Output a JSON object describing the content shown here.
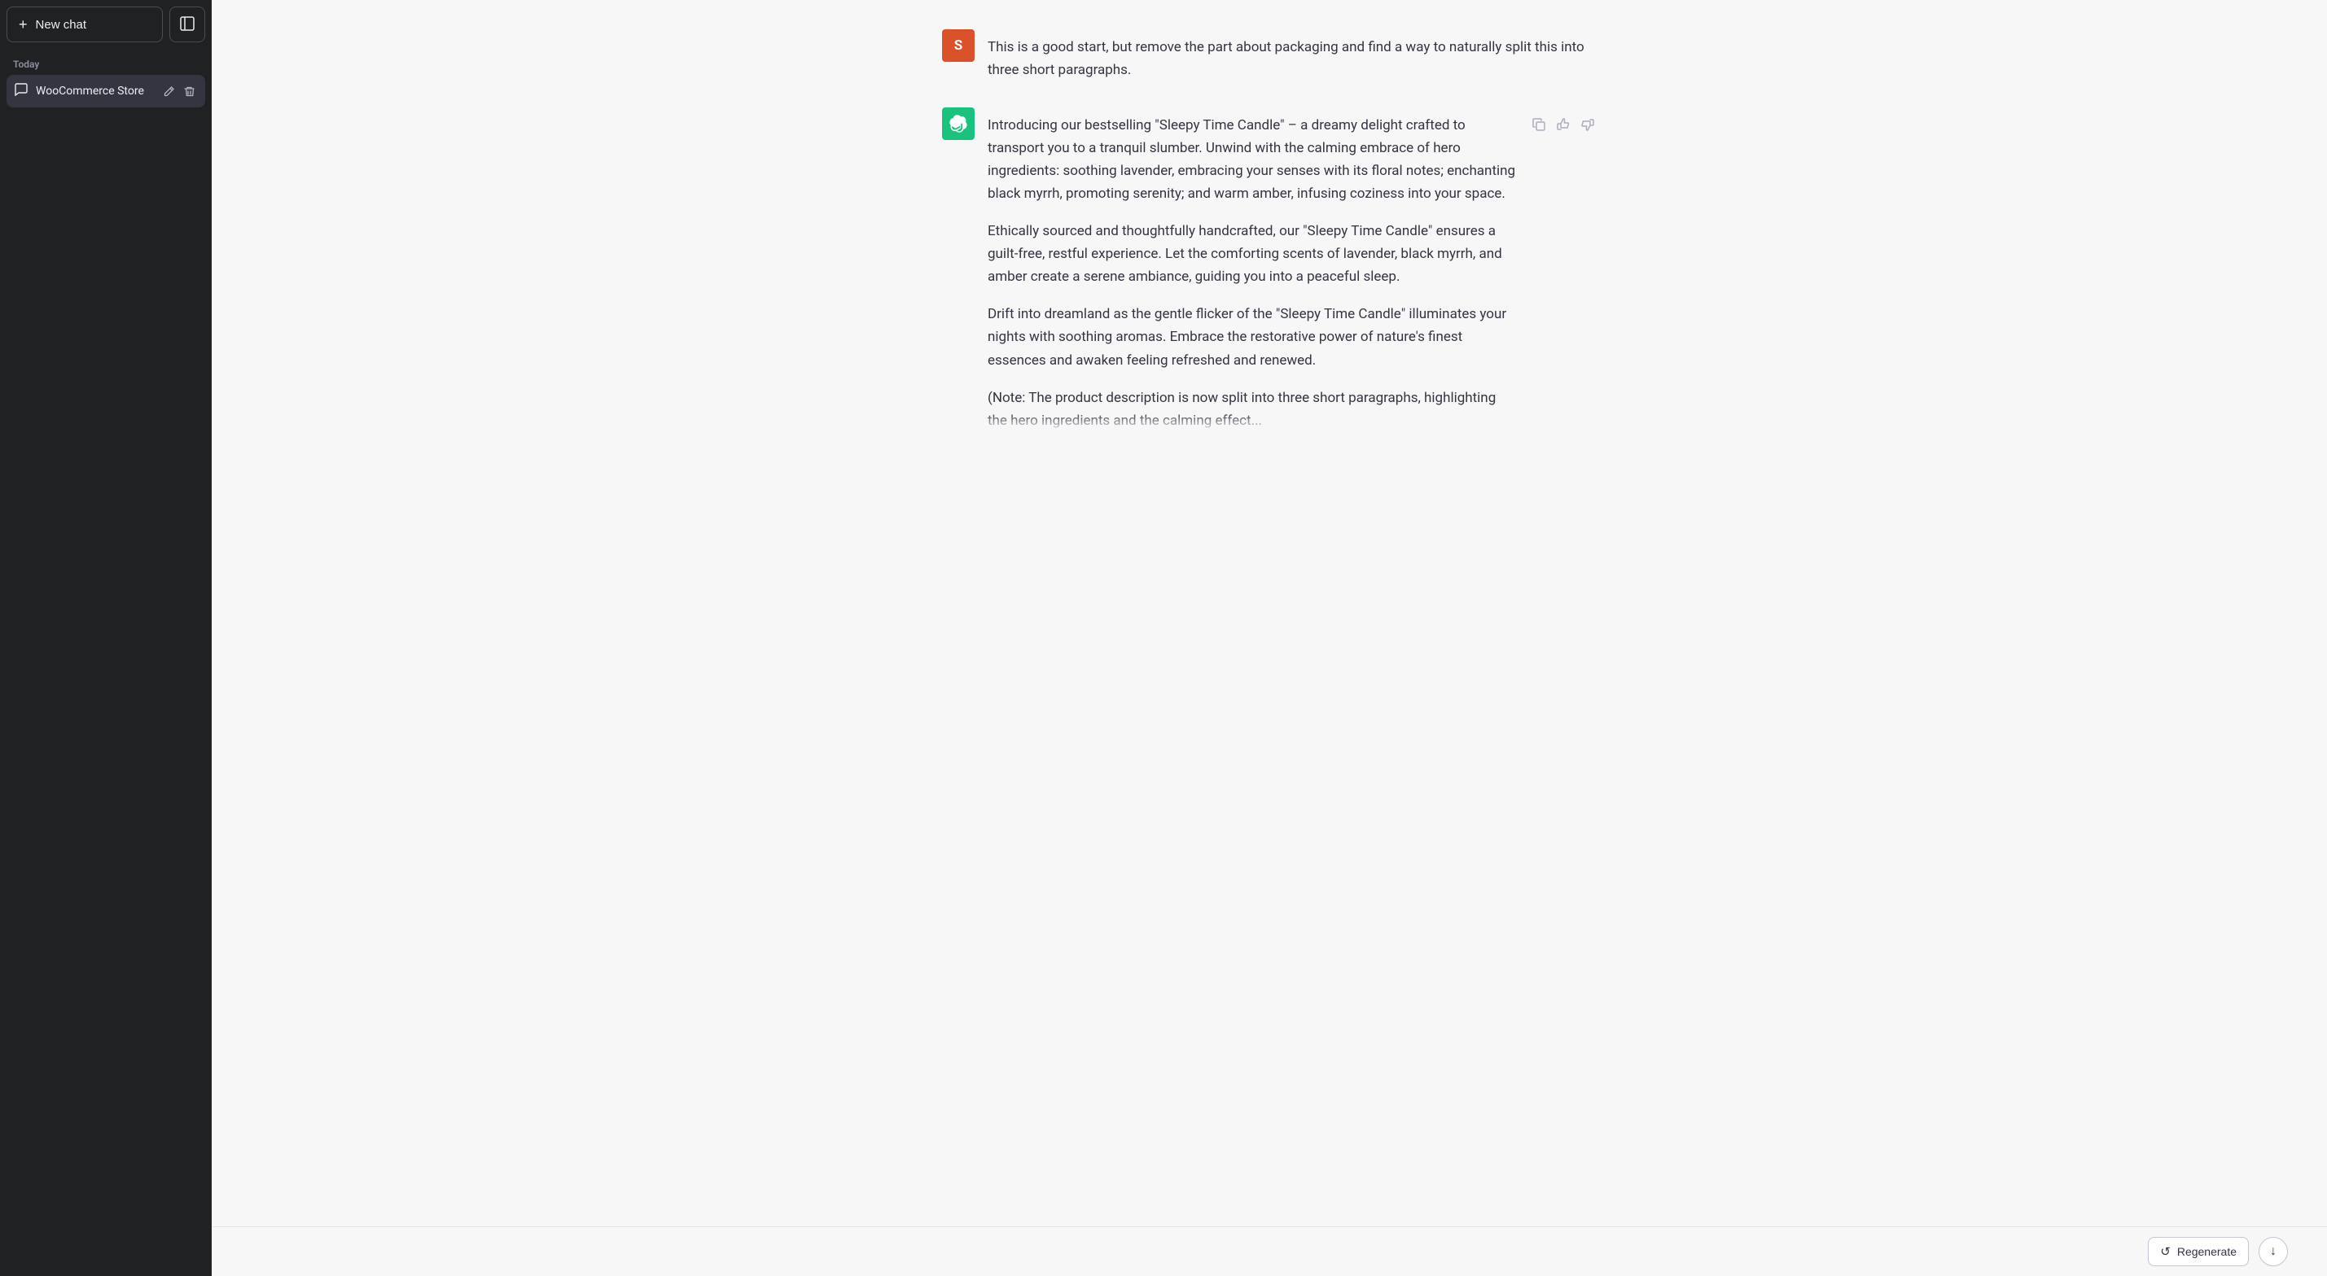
{
  "sidebar": {
    "new_chat_label": "New chat",
    "toggle_icon": "▣",
    "today_label": "Today",
    "chat_items": [
      {
        "id": "woocommerce-store",
        "label": "WooCommerce Store",
        "icon": "chat"
      }
    ]
  },
  "chat": {
    "messages": [
      {
        "id": "user-msg-1",
        "role": "user",
        "avatar_letter": "S",
        "text": "This is a good start, but remove the part about packaging and find a way to naturally split this into three short paragraphs."
      },
      {
        "id": "assistant-msg-1",
        "role": "assistant",
        "paragraphs": [
          "Introducing our bestselling \"Sleepy Time Candle\" – a dreamy delight crafted to transport you to a tranquil slumber. Unwind with the calming embrace of hero ingredients: soothing lavender, embracing your senses with its floral notes; enchanting black myrrh, promoting serenity; and warm amber, infusing coziness into your space.",
          "Ethically sourced and thoughtfully handcrafted, our \"Sleepy Time Candle\" ensures a guilt-free, restful experience. Let the comforting scents of lavender, black myrrh, and amber create a serene ambiance, guiding you into a peaceful sleep.",
          "Drift into dreamland as the gentle flicker of the \"Sleepy Time Candle\" illuminates your nights with soothing aromas. Embrace the restorative power of nature's finest essences and awaken feeling refreshed and renewed.",
          "(Note: The product description is now split into three short paragraphs, highlighting the hero ingredients and the calming effect..."
        ]
      }
    ]
  },
  "bottom_bar": {
    "regenerate_label": "Regenerate",
    "scroll_down_icon": "↓",
    "regenerate_icon": "↺"
  },
  "actions": {
    "copy_icon": "⧉",
    "thumbs_up_icon": "👍",
    "thumbs_down_icon": "👎",
    "edit_icon": "✎",
    "delete_icon": "🗑"
  }
}
